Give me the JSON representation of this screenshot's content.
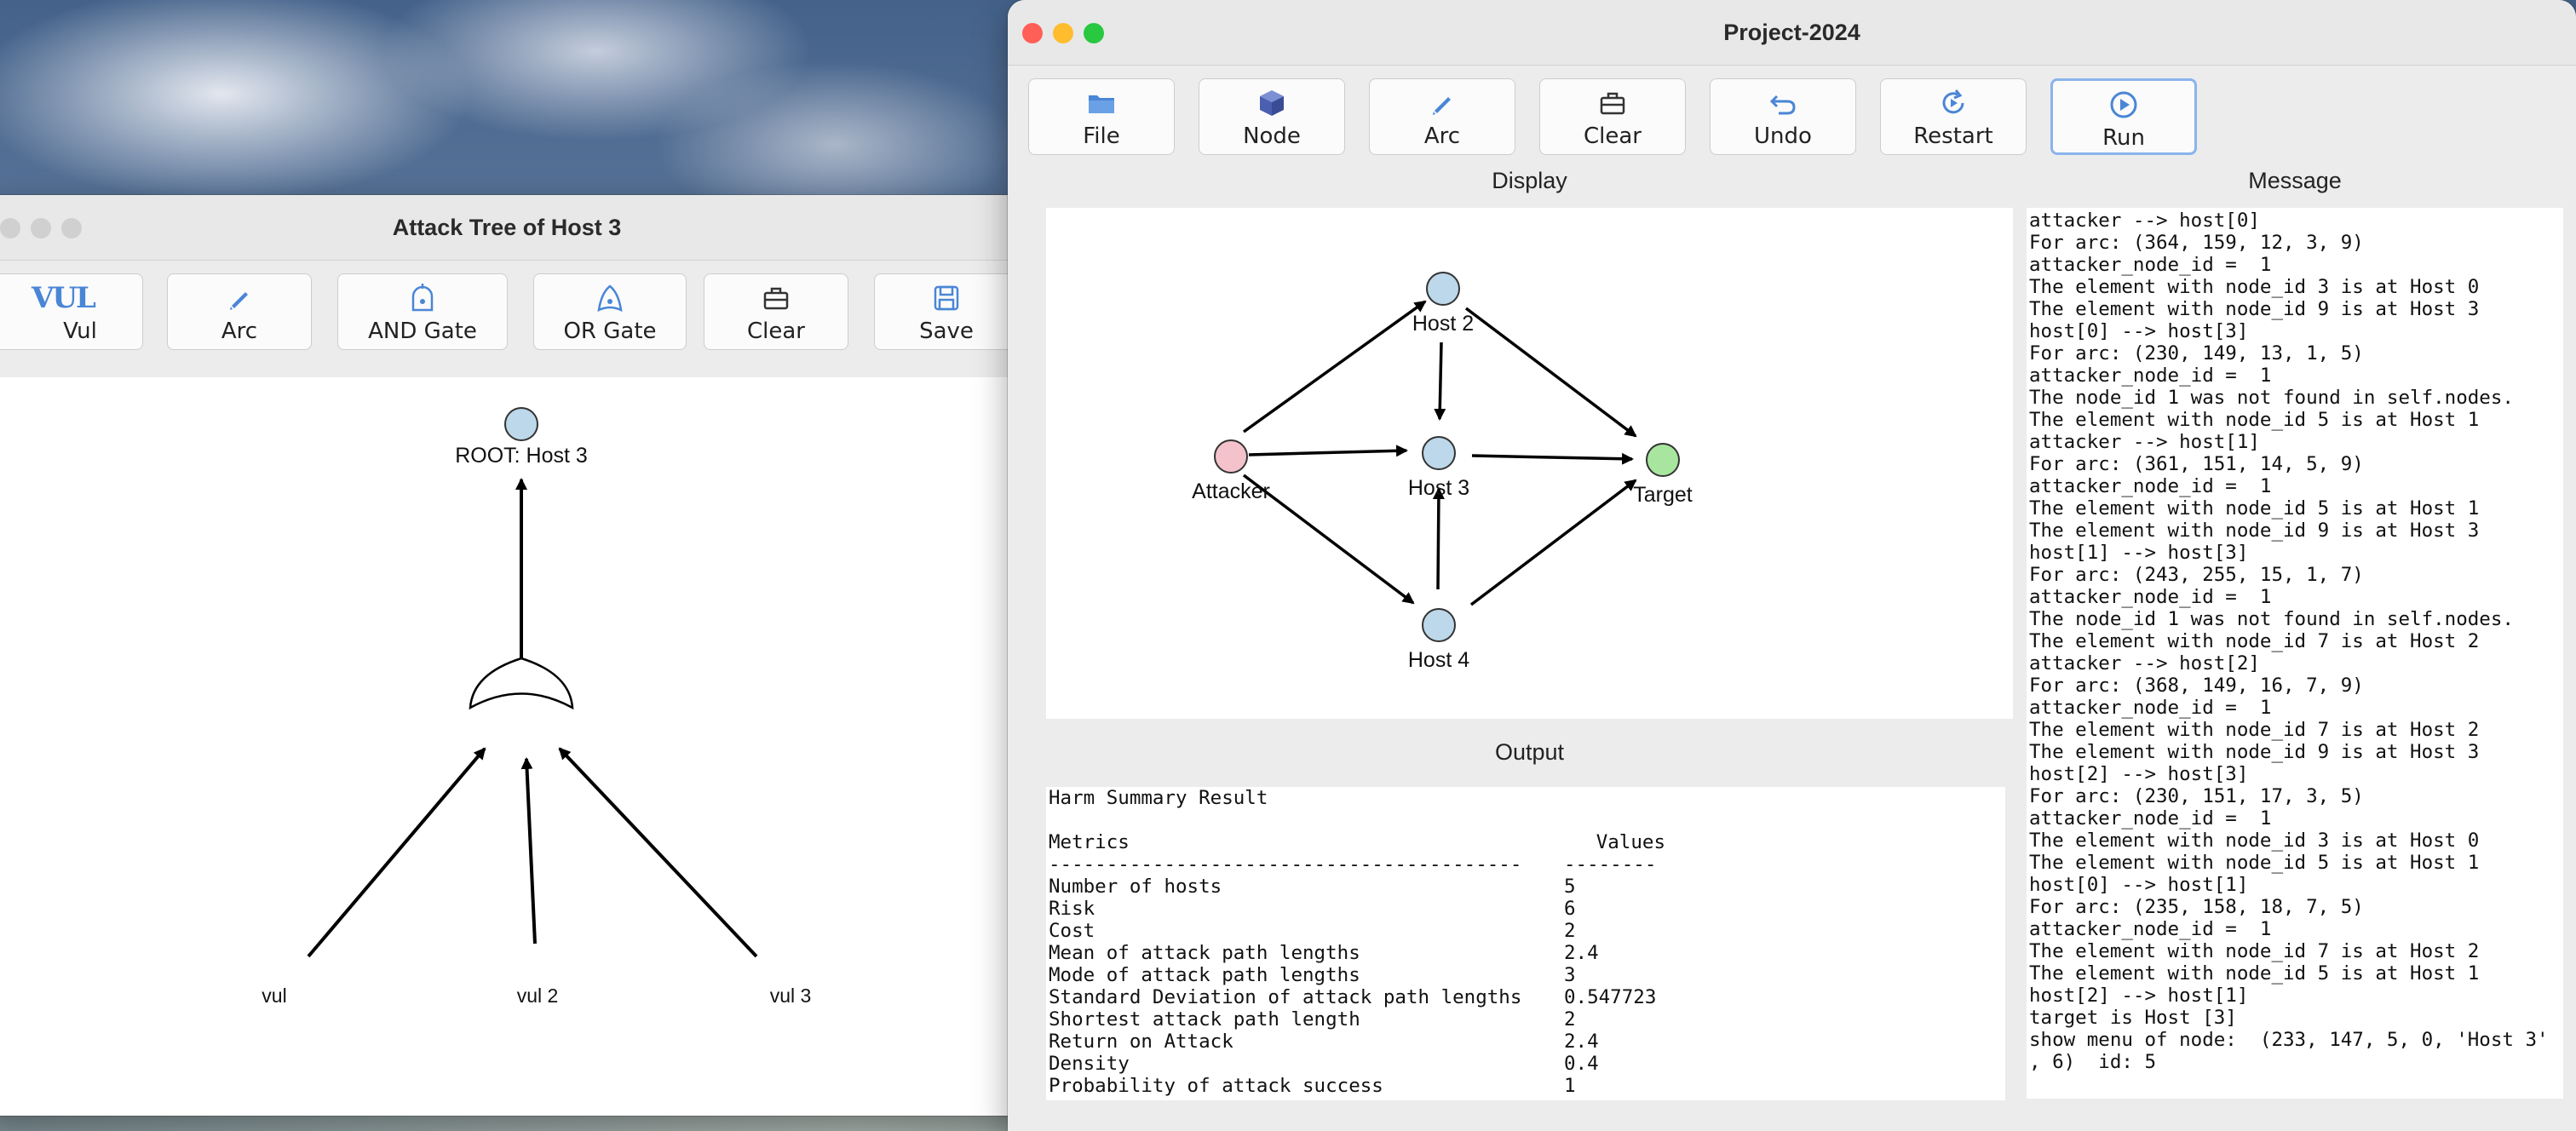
{
  "attack_tree_window": {
    "title": "Attack Tree of Host 3",
    "toolbar": [
      {
        "label": "Vul",
        "icon": "vul-text-icon"
      },
      {
        "label": "Arc",
        "icon": "pen-icon"
      },
      {
        "label": "AND Gate",
        "icon": "and-gate-icon"
      },
      {
        "label": "OR Gate",
        "icon": "or-gate-icon"
      },
      {
        "label": "Clear",
        "icon": "toolbox-icon"
      },
      {
        "label": "Save",
        "icon": "save-icon"
      }
    ],
    "vul_icon_text": "VUL",
    "root_label": "ROOT: Host 3",
    "leaves": [
      "vul",
      "vul 2",
      "vul 3"
    ]
  },
  "project_window": {
    "title": "Project-2024",
    "toolbar": [
      {
        "label": "File",
        "icon": "folder-icon"
      },
      {
        "label": "Node",
        "icon": "cube-icon"
      },
      {
        "label": "Arc",
        "icon": "pen-icon"
      },
      {
        "label": "Clear",
        "icon": "toolbox-icon"
      },
      {
        "label": "Undo",
        "icon": "undo-icon"
      },
      {
        "label": "Restart",
        "icon": "restart-icon"
      },
      {
        "label": "Run",
        "icon": "play-icon"
      }
    ],
    "display_label": "Display",
    "output_label": "Output",
    "message_label": "Message",
    "graph_nodes": {
      "attacker": "Attacker",
      "host2": "Host 2",
      "host3": "Host 3",
      "host4": "Host 4",
      "target": "Target"
    },
    "output": {
      "title": "Harm Summary Result",
      "col_metrics": "Metrics",
      "col_values": "Values",
      "rule_metrics": "-----------------------------------------",
      "rule_values": "--------",
      "rows": [
        {
          "metric": "Number of hosts",
          "value": "5"
        },
        {
          "metric": "Risk",
          "value": "6"
        },
        {
          "metric": "Cost",
          "value": "2"
        },
        {
          "metric": "Mean of attack path lengths",
          "value": "2.4"
        },
        {
          "metric": "Mode of attack path lengths",
          "value": "3"
        },
        {
          "metric": "Standard Deviation of attack path lengths",
          "value": "0.547723"
        },
        {
          "metric": "Shortest attack path length",
          "value": "2"
        },
        {
          "metric": "Return on Attack",
          "value": "2.4"
        },
        {
          "metric": "Density",
          "value": "0.4"
        },
        {
          "metric": "Probability of attack success",
          "value": "1"
        }
      ]
    },
    "messages": [
      "attacker --> host[0]",
      "For arc: (364, 159, 12, 3, 9)",
      "attacker_node_id =  1",
      "The element with node_id 3 is at Host 0",
      "The element with node_id 9 is at Host 3",
      "host[0] --> host[3]",
      "For arc: (230, 149, 13, 1, 5)",
      "attacker_node_id =  1",
      "The node_id 1 was not found in self.nodes.",
      "The element with node_id 5 is at Host 1",
      "attacker --> host[1]",
      "For arc: (361, 151, 14, 5, 9)",
      "attacker_node_id =  1",
      "The element with node_id 5 is at Host 1",
      "The element with node_id 9 is at Host 3",
      "host[1] --> host[3]",
      "For arc: (243, 255, 15, 1, 7)",
      "attacker_node_id =  1",
      "The node_id 1 was not found in self.nodes.",
      "The element with node_id 7 is at Host 2",
      "attacker --> host[2]",
      "For arc: (368, 149, 16, 7, 9)",
      "attacker_node_id =  1",
      "The element with node_id 7 is at Host 2",
      "The element with node_id 9 is at Host 3",
      "host[2] --> host[3]",
      "For arc: (230, 151, 17, 3, 5)",
      "attacker_node_id =  1",
      "The element with node_id 3 is at Host 0",
      "The element with node_id 5 is at Host 1",
      "host[0] --> host[1]",
      "For arc: (235, 158, 18, 7, 5)",
      "attacker_node_id =  1",
      "The element with node_id 7 is at Host 2",
      "The element with node_id 5 is at Host 1",
      "host[2] --> host[1]",
      "target is Host [3]",
      "show menu of node:  (233, 147, 5, 0, 'Host 3'",
      ", 6)  id: 5"
    ]
  },
  "colors": {
    "node_blue": "#bcd8ea",
    "attacker_pink": "#f4c2ca",
    "target_green": "#a8e6a0",
    "accent_active": "#8ab4ec",
    "icon_blue": "#4a86d6"
  }
}
